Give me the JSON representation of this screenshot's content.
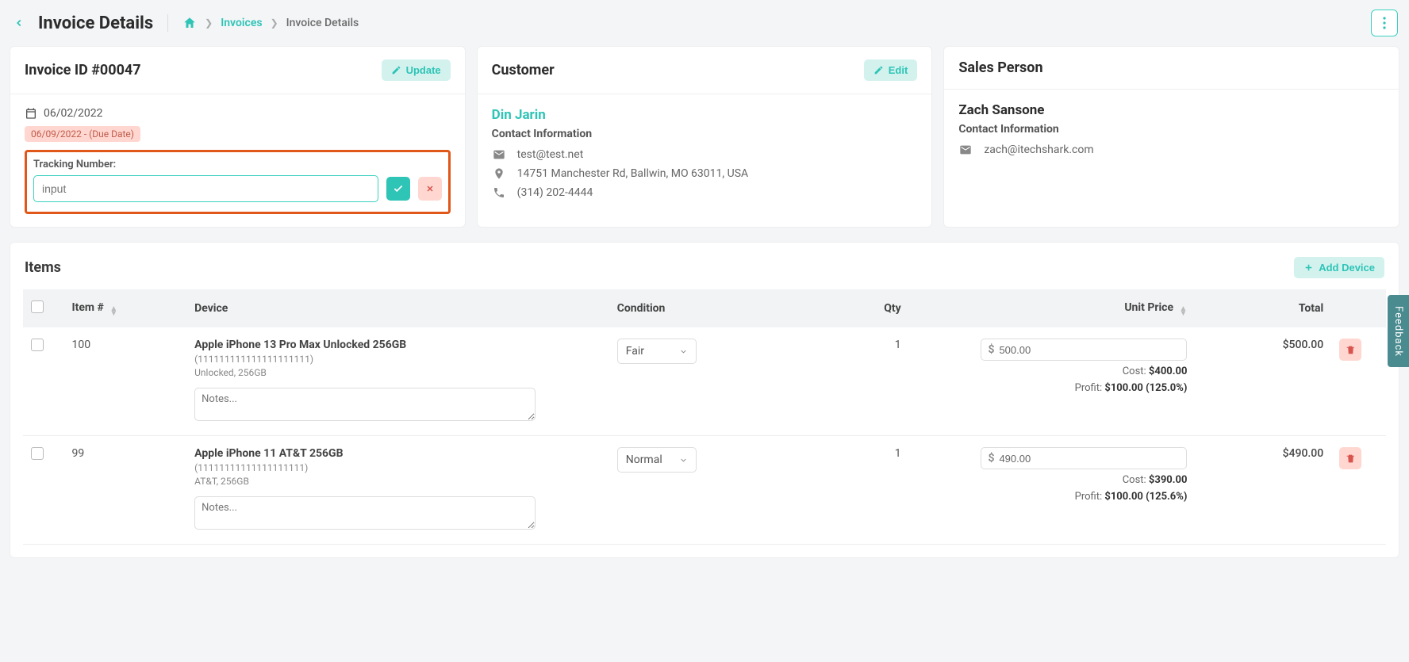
{
  "header": {
    "title": "Invoice Details",
    "breadcrumb_invoices": "Invoices",
    "breadcrumb_current": "Invoice Details"
  },
  "invoice_card": {
    "title": "Invoice ID #00047",
    "update_label": "Update",
    "date": "06/02/2022",
    "due_badge": "06/09/2022 - (Due Date)",
    "tracking_label": "Tracking Number:",
    "tracking_placeholder": "input"
  },
  "customer_card": {
    "title": "Customer",
    "edit_label": "Edit",
    "name": "Din Jarin",
    "contact_heading": "Contact Information",
    "email": "test@test.net",
    "address": "14751 Manchester Rd, Ballwin, MO 63011, USA",
    "phone": "(314) 202-4444"
  },
  "sales_card": {
    "title": "Sales Person",
    "name": "Zach Sansone",
    "contact_heading": "Contact Information",
    "email": "zach@itechshark.com"
  },
  "items": {
    "title": "Items",
    "add_label": "Add Device",
    "columns": {
      "item": "Item #",
      "device": "Device",
      "condition": "Condition",
      "qty": "Qty",
      "unit_price": "Unit Price",
      "total": "Total"
    },
    "rows": [
      {
        "item_no": "100",
        "device_name": "Apple iPhone 13 Pro Max Unlocked 256GB",
        "device_serial": "(111111111111111111111)",
        "device_variant": "Unlocked, 256GB",
        "notes_placeholder": "Notes...",
        "condition": "Fair",
        "qty": "1",
        "price": "500.00",
        "cost_label": "Cost:",
        "cost": "$400.00",
        "profit_label": "Profit:",
        "profit": "$100.00 (125.0%)",
        "total": "$500.00"
      },
      {
        "item_no": "99",
        "device_name": "Apple iPhone 11 AT&T 256GB",
        "device_serial": "(11111111111111111111)",
        "device_variant": "AT&T, 256GB",
        "notes_placeholder": "Notes...",
        "condition": "Normal",
        "qty": "1",
        "price": "490.00",
        "cost_label": "Cost:",
        "cost": "$390.00",
        "profit_label": "Profit:",
        "profit": "$100.00 (125.6%)",
        "total": "$490.00"
      }
    ]
  },
  "feedback_label": "Feedback"
}
